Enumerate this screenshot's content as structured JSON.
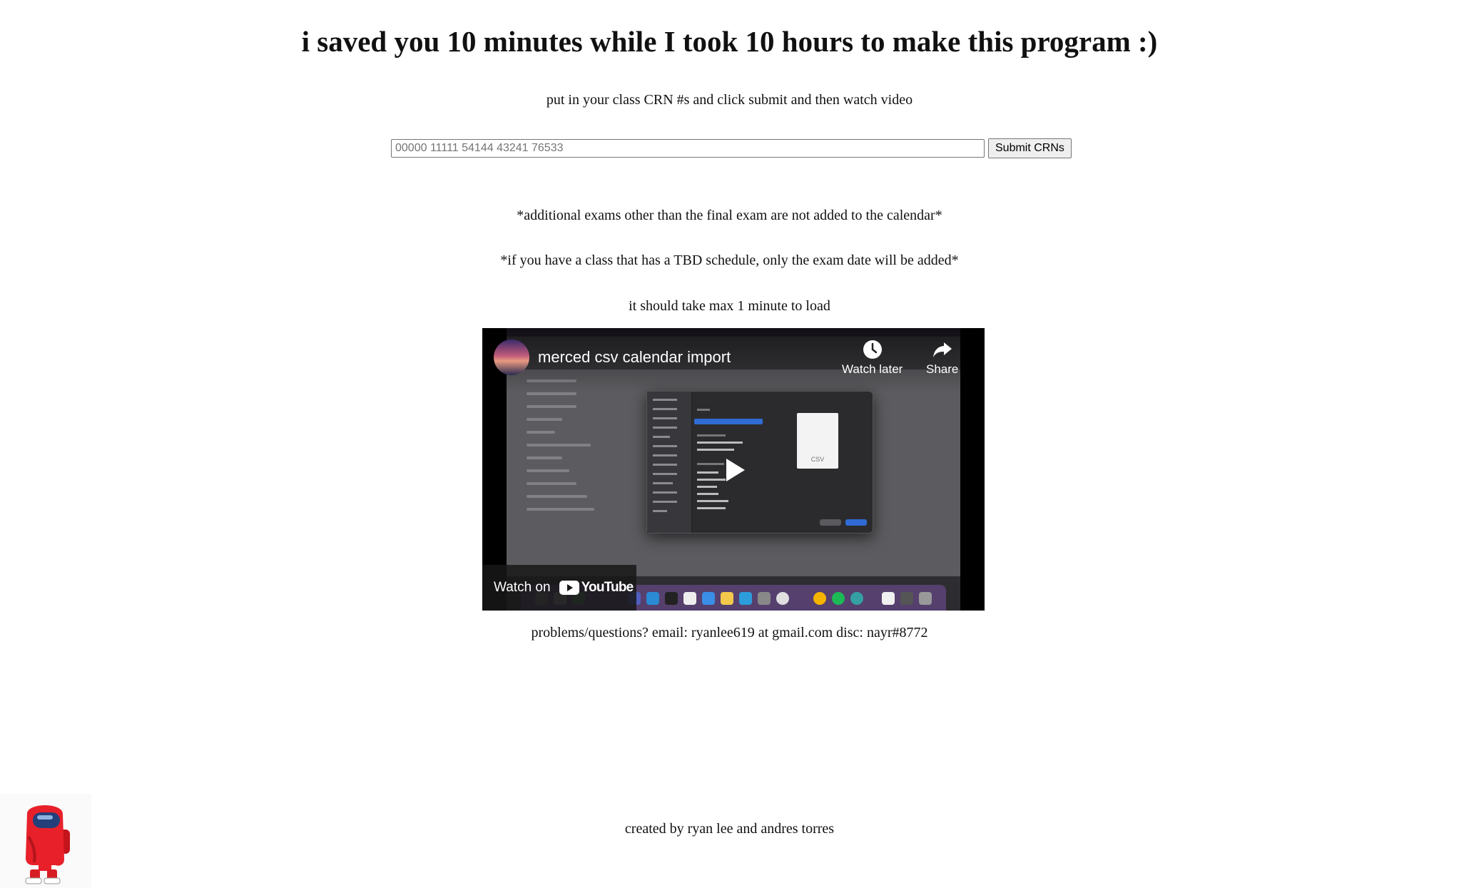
{
  "page": {
    "title": "i saved you 10 minutes while I took 10 hours to make this program :)",
    "instructions": "put in your class CRN #s and click submit and then watch video"
  },
  "form": {
    "crn_placeholder": "00000 11111 54144 43241 76533",
    "crn_value": "",
    "submit_label": "Submit CRNs"
  },
  "notes": {
    "exams_note": "*additional exams other than the final exam are not added to the calendar*",
    "tbd_note": "*if you have a class that has a TBD schedule, only the exam date will be added*",
    "load_time": "it should take max 1 minute to load"
  },
  "video": {
    "title": "merced csv calendar import",
    "watch_later_label": "Watch later",
    "share_label": "Share",
    "watch_on_label": "Watch on",
    "youtube_label": "YouTube",
    "csv_label": "CSV",
    "colors": {
      "youtube_red": "#ff0000",
      "finder_selection": "#2f6bd3"
    }
  },
  "contact": {
    "text": "problems/questions? email: ryanlee619 at gmail.com disc: nayr#8772"
  },
  "footer": {
    "credits": "created by ryan lee and andres torres"
  },
  "decoration": {
    "character": "among-us-crewmate-icon"
  }
}
